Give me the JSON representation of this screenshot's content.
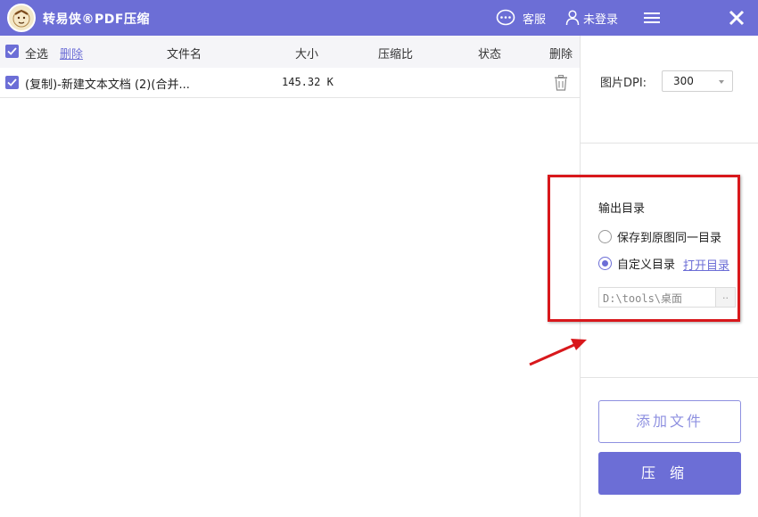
{
  "titlebar": {
    "app_title": "转易侠®PDF压缩",
    "service_label": "客服",
    "login_label": "未登录",
    "colors": {
      "brand": "#6c6ed6"
    }
  },
  "list": {
    "header": {
      "select_all": "全选",
      "delete_link": "删除",
      "col_filename": "文件名",
      "col_size": "大小",
      "col_ratio": "压缩比",
      "col_status": "状态",
      "col_delete": "删除"
    },
    "rows": [
      {
        "checked": true,
        "filename": "(复制)-新建文本文档 (2)(合并...",
        "size": "145.32 K",
        "ratio": "",
        "status": ""
      }
    ]
  },
  "settings": {
    "dpi_label": "图片DPI:",
    "dpi_value": "300",
    "output_title": "输出目录",
    "option_same_dir": "保存到原图同一目录",
    "option_custom_dir": "自定义目录",
    "selected_option": "custom",
    "open_dir_link": "打开目录",
    "path_value": "D:\\tools\\桌面",
    "browse_label": "..",
    "add_file_button": "添加文件",
    "compress_button": "压缩"
  },
  "icons": [
    "app-logo-icon",
    "chat-bubble-icon",
    "user-icon",
    "menu-icon",
    "close-icon",
    "checkbox-checked-icon",
    "trash-icon",
    "dropdown-caret-icon"
  ]
}
